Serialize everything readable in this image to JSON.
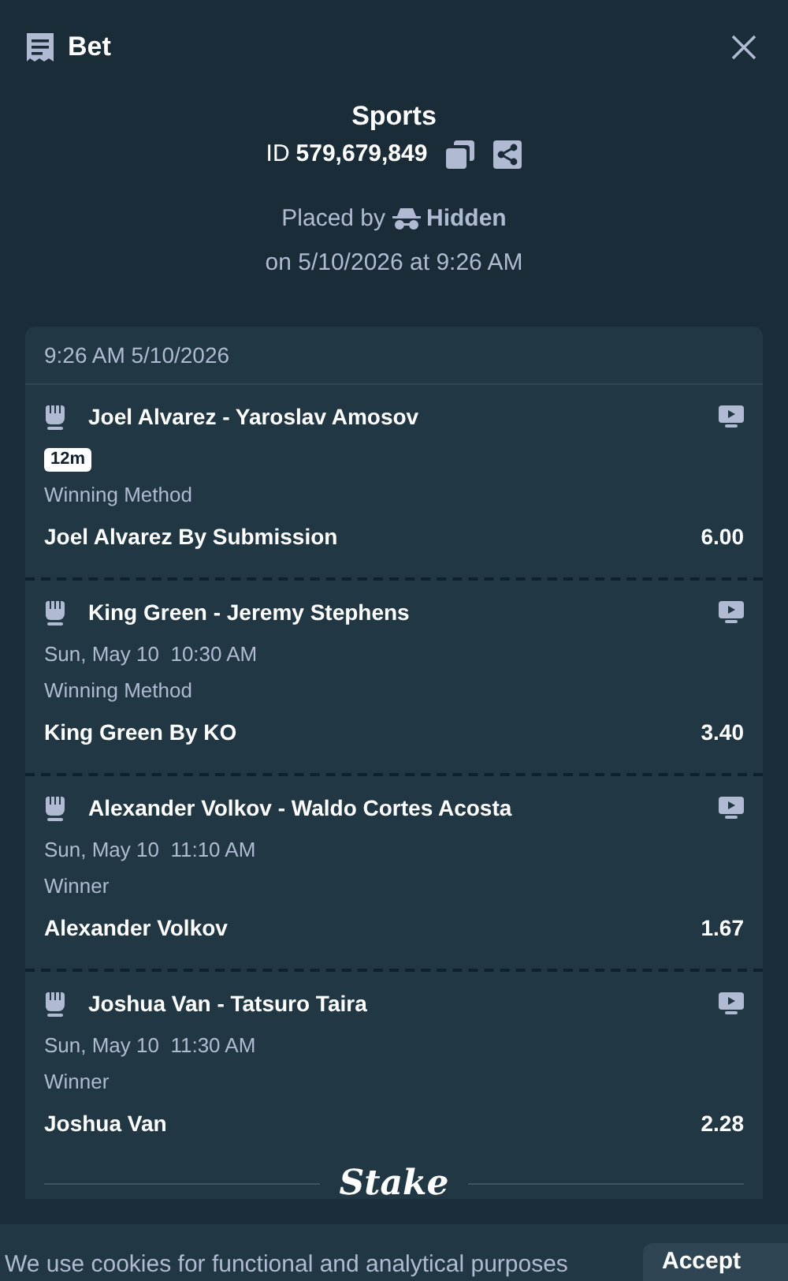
{
  "header": {
    "title": "Bet"
  },
  "summary": {
    "type": "Sports",
    "id_label": "ID",
    "id_value": "579,679,849",
    "placed_by_label": "Placed by",
    "placed_by_user": "Hidden",
    "placed_on": "on 5/10/2026 at 9:26 AM"
  },
  "card": {
    "timestamp": "9:26 AM 5/10/2026",
    "legs": [
      {
        "title": "Joel Alvarez - Yaroslav Amosov",
        "kind": "badge",
        "time": "12m",
        "market": "Winning Method",
        "selection": "Joel Alvarez By Submission",
        "odds": "6.00"
      },
      {
        "title": "King Green - Jeremy Stephens",
        "kind": "text",
        "time": "Sun, May 10  10:30 AM",
        "market": "Winning Method",
        "selection": "King Green By KO",
        "odds": "3.40"
      },
      {
        "title": "Alexander Volkov - Waldo Cortes Acosta",
        "kind": "text",
        "time": "Sun, May 10  11:10 AM",
        "market": "Winner",
        "selection": "Alexander Volkov",
        "odds": "1.67"
      },
      {
        "title": "Joshua Van - Tatsuro Taira",
        "kind": "text",
        "time": "Sun, May 10  11:30 AM",
        "market": "Winner",
        "selection": "Joshua Van",
        "odds": "2.28"
      }
    ],
    "logo": "Stake"
  },
  "cookie_banner": {
    "message": "We use cookies for functional and analytical purposes",
    "button": "Accept"
  }
}
